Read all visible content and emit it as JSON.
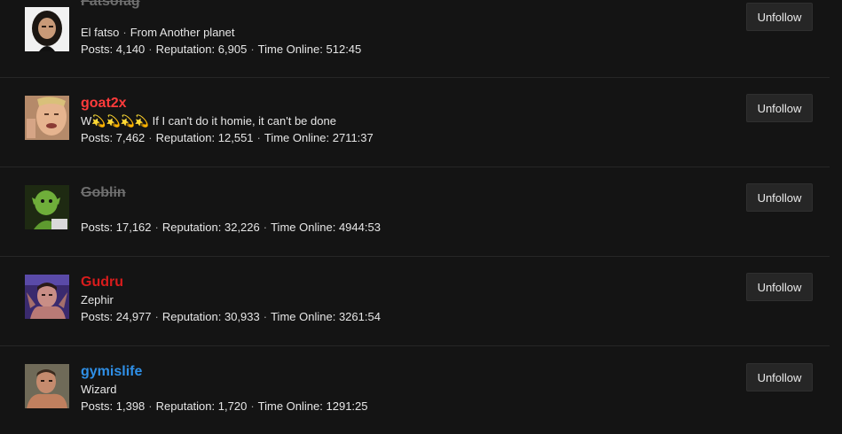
{
  "following": {
    "users": [
      {
        "name": "Fatsofag",
        "name_color": "#6f6f6f",
        "banned": true,
        "title": "El fatso",
        "location": "From Another planet",
        "stats": {
          "posts_label": "Posts:",
          "posts": "4,140",
          "rep_label": "Reputation:",
          "rep": "6,905",
          "time_label": "Time Online:",
          "time": "512:45"
        },
        "button_label": "Unfollow"
      },
      {
        "name": "goat2x",
        "name_color": "#ff3b3b",
        "banned": false,
        "title": "W💫💫💫💫 If I can't do it homie, it can't be done",
        "location": "",
        "stats": {
          "posts_label": "Posts:",
          "posts": "7,462",
          "rep_label": "Reputation:",
          "rep": "12,551",
          "time_label": "Time Online:",
          "time": "2711:37"
        },
        "button_label": "Unfollow"
      },
      {
        "name": "Goblin",
        "name_color": "#6f6f6f",
        "banned": true,
        "title": "",
        "location": "",
        "stats": {
          "posts_label": "Posts:",
          "posts": "17,162",
          "rep_label": "Reputation:",
          "rep": "32,226",
          "time_label": "Time Online:",
          "time": "4944:53"
        },
        "button_label": "Unfollow"
      },
      {
        "name": "Gudru",
        "name_color": "#d81c1c",
        "banned": false,
        "title": "Zephir",
        "location": "",
        "stats": {
          "posts_label": "Posts:",
          "posts": "24,977",
          "rep_label": "Reputation:",
          "rep": "30,933",
          "time_label": "Time Online:",
          "time": "3261:54"
        },
        "button_label": "Unfollow"
      },
      {
        "name": "gymislife",
        "name_color": "#2f8fe6",
        "banned": false,
        "title": "Wizard",
        "location": "",
        "stats": {
          "posts_label": "Posts:",
          "posts": "1,398",
          "rep_label": "Reputation:",
          "rep": "1,720",
          "time_label": "Time Online:",
          "time": "1291:25"
        },
        "button_label": "Unfollow"
      }
    ]
  }
}
